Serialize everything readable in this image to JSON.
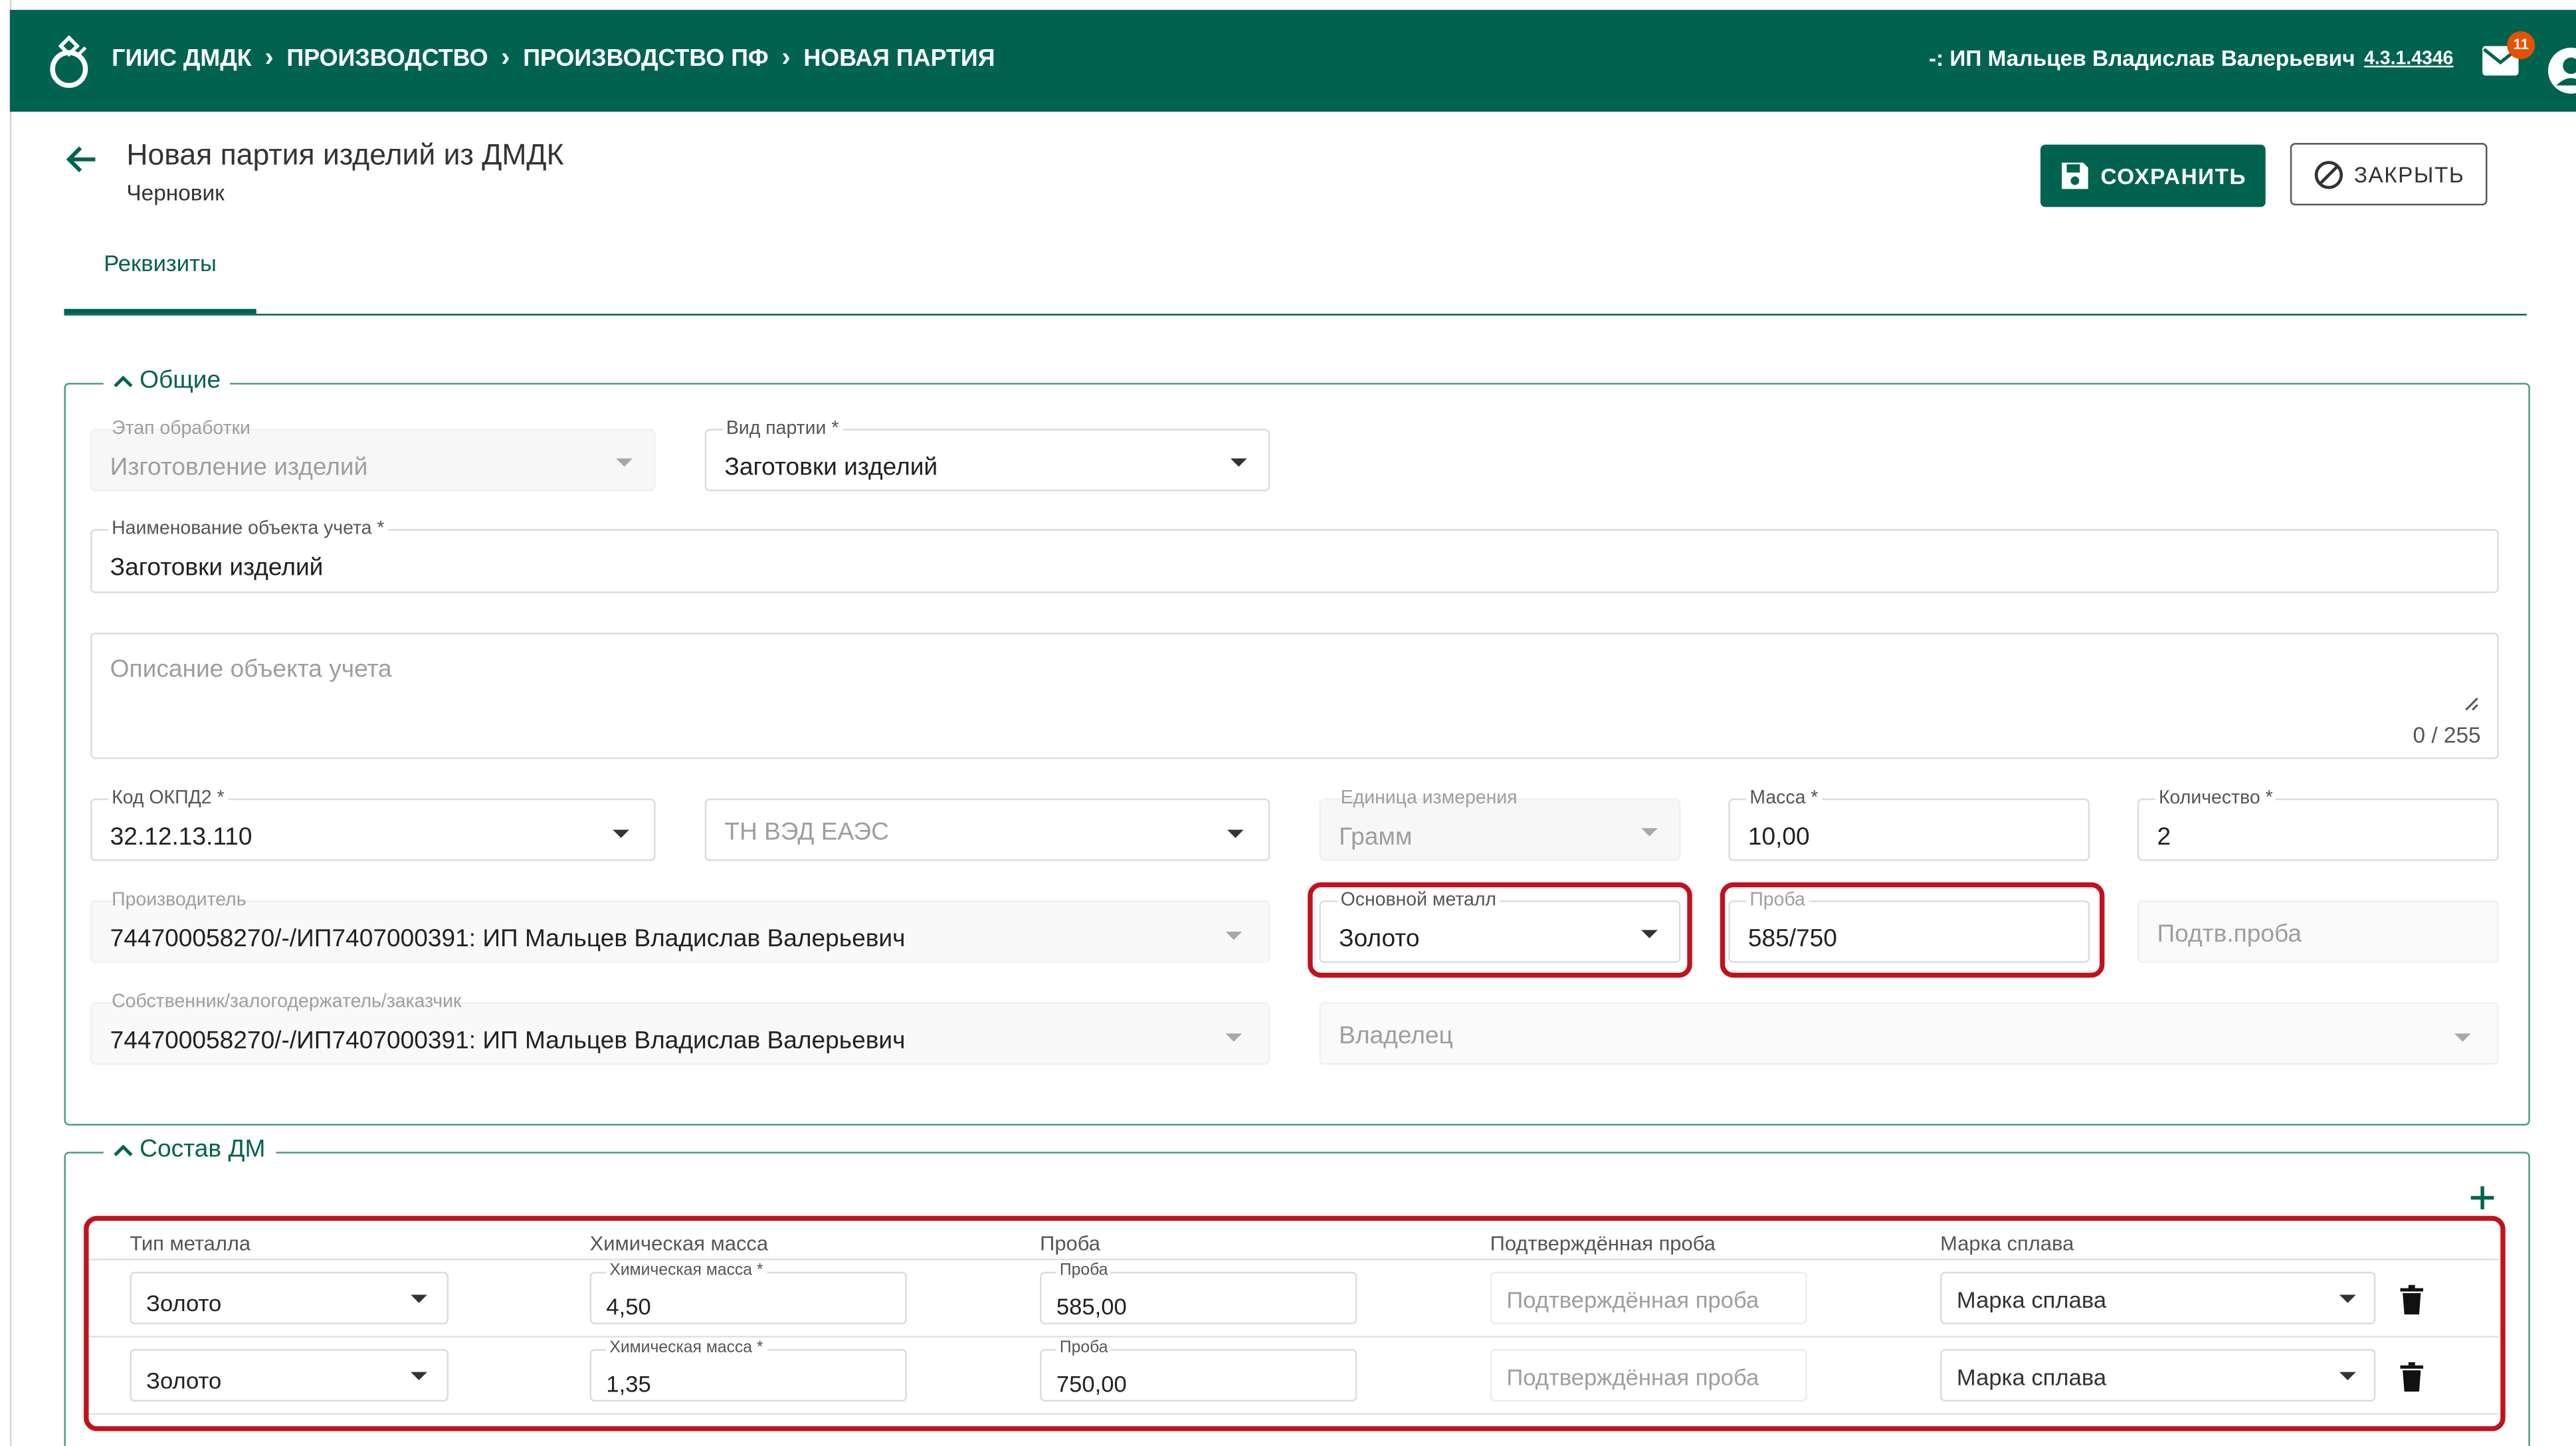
{
  "header": {
    "breadcrumbs": [
      "ГИИС ДМДК",
      "ПРОИЗВОДСТВО",
      "ПРОИЗВОДСТВО ПФ",
      "НОВАЯ ПАРТИЯ"
    ],
    "user": "-: ИП Мальцев Владислав Валерьевич",
    "version": "4.3.1.4346",
    "notifications": "11"
  },
  "page": {
    "title": "Новая партия изделий из ДМДК",
    "status": "Черновик",
    "save_label": "СОХРАНИТЬ",
    "close_label": "ЗАКРЫТЬ",
    "tab": "Реквизиты"
  },
  "general": {
    "legend": "Общие",
    "stage": {
      "label": "Этап обработки",
      "value": "Изготовление изделий"
    },
    "batch_type": {
      "label": "Вид партии *",
      "value": "Заготовки изделий"
    },
    "object_name": {
      "label": "Наименование объекта учета *",
      "value": "Заготовки изделий"
    },
    "description": {
      "placeholder": "Описание объекта учета",
      "counter": "0 / 255"
    },
    "okpd": {
      "label": "Код ОКПД2 *",
      "value": "32.12.13.110"
    },
    "tnved": {
      "placeholder": "ТН ВЭД ЕАЭС"
    },
    "unit": {
      "label": "Единица измерения",
      "value": "Грамм"
    },
    "mass": {
      "label": "Масса *",
      "value": "10,00"
    },
    "quantity": {
      "label": "Количество *",
      "value": "2"
    },
    "producer": {
      "label": "Производитель",
      "value": "744700058270/-/ИП7407000391: ИП Мальцев Владислав Валерьевич"
    },
    "main_metal": {
      "label": "Основной металл",
      "value": "Золото"
    },
    "assay": {
      "label": "Проба",
      "value": "585/750"
    },
    "confirmed_assay": {
      "placeholder": "Подтв.проба"
    },
    "owner_pledger": {
      "label": "Собственник/залогодержатель/заказчик",
      "value": "744700058270/-/ИП7407000391: ИП Мальцев Владислав Валерьевич"
    },
    "owner": {
      "placeholder": "Владелец"
    }
  },
  "composition": {
    "legend": "Состав ДМ",
    "columns": [
      "Тип металла",
      "Химическая масса",
      "Проба",
      "Подтверждённая проба",
      "Марка сплава"
    ],
    "rows": [
      {
        "metal": "Золото",
        "chem_label": "Химическая масса *",
        "chem_mass": "4,50",
        "assay_label": "Проба",
        "assay": "585,00",
        "confirmed_placeholder": "Подтверждённая проба",
        "alloy_placeholder": "Марка сплава"
      },
      {
        "metal": "Золото",
        "chem_label": "Химическая масса *",
        "chem_mass": "1,35",
        "assay_label": "Проба",
        "assay": "750,00",
        "confirmed_placeholder": "Подтверждённая проба",
        "alloy_placeholder": "Марка сплава"
      }
    ]
  },
  "colors": {
    "brand": "#00634f",
    "highlight": "#c1121c",
    "badge": "#e65100"
  }
}
